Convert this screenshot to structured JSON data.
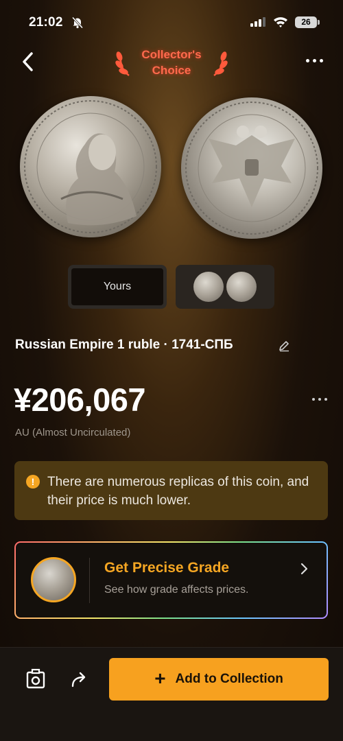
{
  "status_bar": {
    "time": "21:02",
    "battery": "26",
    "icons": [
      "bell-slash-icon",
      "signal-icon",
      "wifi-icon",
      "battery-icon"
    ]
  },
  "header": {
    "back_icon": "chevron-left-icon",
    "badge_line1": "Collector's",
    "badge_line2": "Choice",
    "more_icon": "ellipsis-icon"
  },
  "thumbnails": {
    "yours_label": "Yours"
  },
  "coin": {
    "title": "Russian Empire 1 ruble · 1741-СПБ",
    "price": "¥206,067",
    "grade": "AU (Almost Uncirculated)"
  },
  "warning": {
    "icon": "exclamation-circle-icon",
    "text": "There are numerous replicas of this coin, and their price is much lower."
  },
  "grade_card": {
    "title": "Get Precise Grade",
    "subtitle": "See how grade affects prices."
  },
  "bottom_bar": {
    "add_label": "Add to Collection",
    "plus": "+"
  },
  "colors": {
    "accent": "#f7a11f",
    "badge": "#ff6a4d",
    "warning_bg": "#4d3912"
  }
}
